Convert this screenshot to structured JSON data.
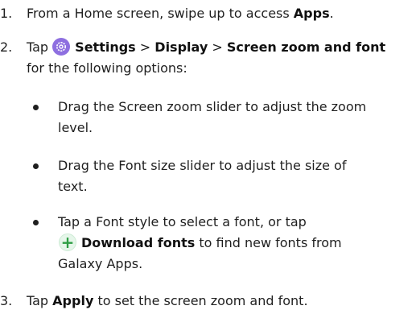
{
  "steps": [
    {
      "number": "1.",
      "text": "From a Home screen, swipe up to access ",
      "bold": "Apps",
      "end": "."
    },
    {
      "number": "2.",
      "prefix": "Tap ",
      "icon": "settings-gear-icon",
      "settings": "Settings",
      "sep1": " > ",
      "display": "Display",
      "sep2": " > ",
      "zoom_font": "Screen zoom and font",
      "line2": "for the following options:",
      "bullets": [
        {
          "line1": "Drag the Screen zoom slider to adjust the zoom",
          "line2": "level."
        },
        {
          "line1": "Drag the Font size slider to adjust the size of",
          "line2": "text."
        },
        {
          "line1": "Tap a Font style to select a font, or tap",
          "icon": "plus-add-icon",
          "download": "Download fonts",
          "line2_rest": " to find new fonts from",
          "line3": "Galaxy Apps."
        }
      ]
    },
    {
      "number": "3.",
      "prefix": "Tap ",
      "bold": "Apply",
      "rest": " to set the screen zoom and font."
    }
  ],
  "colors": {
    "settings_icon": "#8e6fe0",
    "plus_icon": "#2e9e44"
  }
}
